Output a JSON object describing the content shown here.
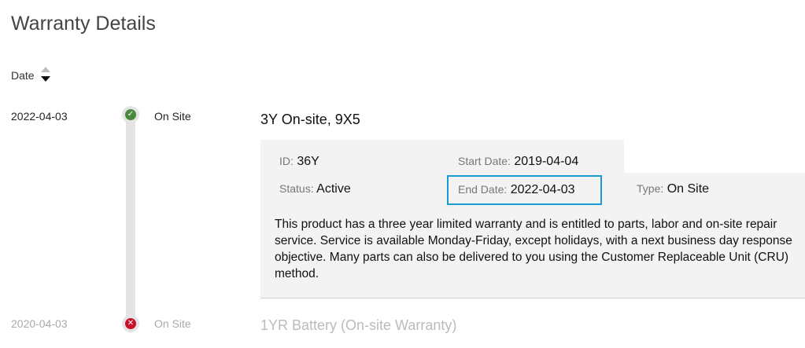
{
  "page": {
    "title": "Warranty Details"
  },
  "sort": {
    "label": "Date",
    "direction": "descending"
  },
  "colors": {
    "accent_highlight": "#1c9ad6",
    "status_ok": "#4a8a3a",
    "status_expired": "#c8102e"
  },
  "warranties": [
    {
      "date": "2022-04-03",
      "status_icon": "check-circle-icon",
      "status": "On Site",
      "title": "3Y On-site, 9X5",
      "id_label": "ID:",
      "id": "36Y",
      "start_label": "Start Date:",
      "start": "2019-04-04",
      "status_label": "Status:",
      "status_value": "Active",
      "end_label": "End Date:",
      "end": "2022-04-03",
      "type_label": "Type:",
      "type": "On Site",
      "description": "This product has a three year limited warranty and is entitled to parts, labor and on-site repair service. Service is available Monday-Friday, except holidays, with a next business day response objective. Many parts can also be delivered to you using the Customer Replaceable Unit (CRU) method."
    },
    {
      "date": "2020-04-03",
      "status_icon": "x-circle-icon",
      "status": "On Site",
      "title": "1YR Battery (On-site Warranty)"
    }
  ]
}
